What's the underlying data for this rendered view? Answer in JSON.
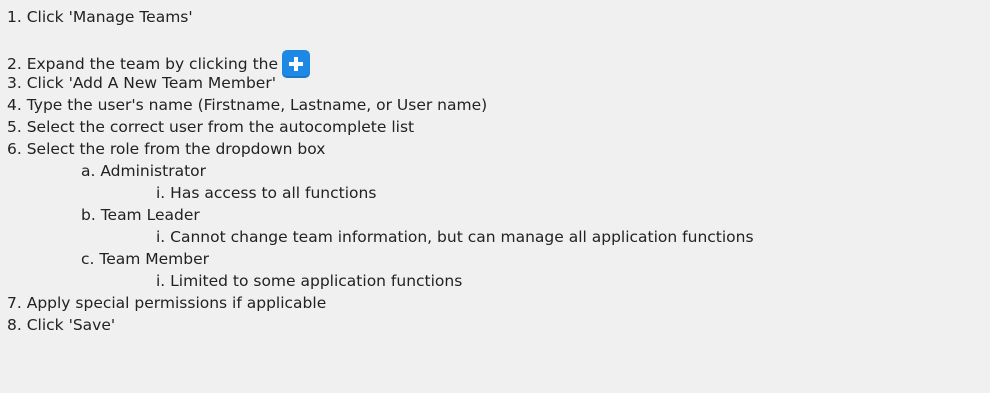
{
  "steps": [
    {
      "text": "1. Click 'Manage Teams'"
    },
    {
      "text": "2. Expand the team by clicking the",
      "icon": "plus-icon",
      "icon_color": "#1e88e5"
    },
    {
      "text": "3. Click 'Add A New Team Member'"
    },
    {
      "text": "4. Type the user's name (Firstname, Lastname, or User name)"
    },
    {
      "text": "5. Select the correct user from the autocomplete list"
    },
    {
      "text": "6. Select the role from the dropdown box"
    },
    {
      "text": "a. Administrator"
    },
    {
      "text": "i. Has access to all functions"
    },
    {
      "text": "b. Team Leader"
    },
    {
      "text": "i. Cannot change team information, but can manage all application functions"
    },
    {
      "text": "c. Team Member"
    },
    {
      "text": "i. Limited to some application functions"
    },
    {
      "text": "7. Apply special permissions if applicable"
    },
    {
      "text": "8. Click 'Save'"
    }
  ]
}
